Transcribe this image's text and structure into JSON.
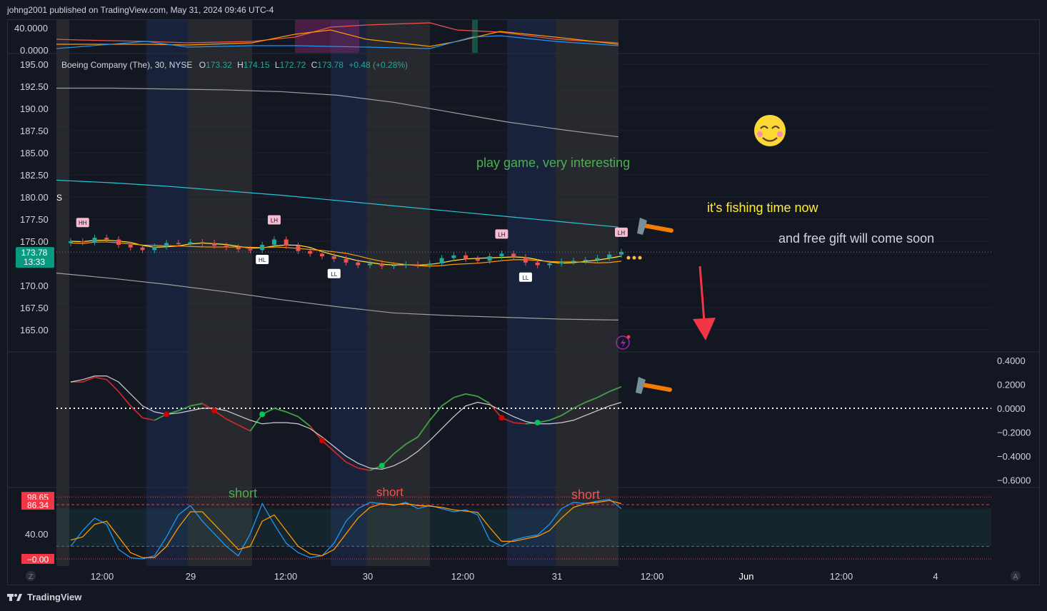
{
  "header": {
    "text": "johng2001 published on TradingView.com, May 31, 2024 09:46 UTC-4"
  },
  "footer": {
    "brand": "TradingView"
  },
  "legend": {
    "symbol": "Boeing Company (The), 30, NYSE",
    "o_label": "O",
    "o": "173.32",
    "h_label": "H",
    "h": "174.15",
    "l_label": "L",
    "l": "172.72",
    "c_label": "C",
    "c": "173.78",
    "change": "+0.48 (+0.28%)"
  },
  "price_badge": {
    "price": "173.78",
    "countdown": "13:33"
  },
  "annotations": {
    "play": "play game, very interesting",
    "fishing": "it's fishing time now",
    "gift": "and free gift will come soon",
    "short1": "short",
    "short2": "short",
    "short3": "short",
    "s_marker": "S"
  },
  "colors": {
    "bg": "#131722",
    "up": "#26a69a",
    "down": "#ef5350",
    "green_text": "#4caf50",
    "yellow_text": "#ffeb3b",
    "red_text": "#f23645",
    "pink_badge": "#f8bbd0"
  },
  "icons": [
    "smiley-icon",
    "hammer-icon",
    "down-arrow-icon",
    "lightning-icon",
    "tradingview-logo-icon"
  ],
  "chart_data": [
    {
      "type": "line",
      "panel": "top-indicator",
      "y_ticks": [
        "40.0000",
        "0.0000"
      ],
      "ylim": [
        0,
        45
      ]
    },
    {
      "type": "candlestick",
      "panel": "price",
      "y_ticks": [
        "195.00",
        "192.50",
        "190.00",
        "187.50",
        "185.00",
        "182.50",
        "180.00",
        "177.50",
        "175.00",
        "170.00",
        "167.50",
        "165.00"
      ],
      "ylim": [
        163.5,
        196.5
      ],
      "x_ticks": [
        "12:00",
        "29",
        "12:00",
        "30",
        "12:00",
        "31",
        "12:00",
        "Jun",
        "12:00",
        "4"
      ],
      "last_price": 173.78,
      "close": [
        175.0,
        174.9,
        175.4,
        175.2,
        174.6,
        174.3,
        174.0,
        174.4,
        174.8,
        174.7,
        174.9,
        174.8,
        174.5,
        174.3,
        174.1,
        174.0,
        174.6,
        175.2,
        174.5,
        173.9,
        173.6,
        173.3,
        173.0,
        172.6,
        172.3,
        172.5,
        172.2,
        172.3,
        172.4,
        172.3,
        172.5,
        173.1,
        173.4,
        173.0,
        172.8,
        173.3,
        173.6,
        173.2,
        172.6,
        172.3,
        172.5,
        172.7,
        172.8,
        172.9,
        173.1,
        173.5,
        173.8
      ],
      "pivots": [
        {
          "label": "HH",
          "idx": 1,
          "pos": "above"
        },
        {
          "label": "LH",
          "idx": 17,
          "pos": "above"
        },
        {
          "label": "HL",
          "idx": 16,
          "pos": "below"
        },
        {
          "label": "LL",
          "idx": 22,
          "pos": "below"
        },
        {
          "label": "LH",
          "idx": 36,
          "pos": "above"
        },
        {
          "label": "LL",
          "idx": 38,
          "pos": "below"
        },
        {
          "label": "LH",
          "idx": 46,
          "pos": "above"
        }
      ],
      "upper_band": [
        192.3,
        192.3,
        192.2,
        192.1,
        191.9,
        191.5,
        190.7,
        189.6,
        188.5,
        187.6,
        186.8
      ],
      "lower_band": [
        171.4,
        170.8,
        170.1,
        169.3,
        168.4,
        167.6,
        166.9,
        166.6,
        166.4,
        166.2,
        166.1
      ],
      "ema_long": [
        181.9,
        181.6,
        181.2,
        180.7,
        180.2,
        179.6,
        179.0,
        178.4,
        177.8,
        177.2,
        176.6
      ]
    },
    {
      "type": "line",
      "panel": "oscillator",
      "y_ticks": [
        "0.4000",
        "0.2000",
        "0.0000",
        "−0.2000",
        "−0.4000",
        "−0.6000"
      ],
      "ylim": [
        -0.62,
        0.42
      ],
      "series": [
        {
          "values": [
            0.22,
            0.22,
            0.26,
            0.24,
            0.14,
            0.02,
            -0.08,
            -0.1,
            -0.05,
            -0.02,
            0.02,
            0.04,
            -0.02,
            -0.09,
            -0.14,
            -0.19,
            -0.05,
            0.0,
            -0.03,
            -0.07,
            -0.15,
            -0.27,
            -0.36,
            -0.45,
            -0.5,
            -0.52,
            -0.48,
            -0.38,
            -0.3,
            -0.24,
            -0.1,
            0.02,
            0.09,
            0.12,
            0.1,
            0.04,
            -0.08,
            -0.12,
            -0.13,
            -0.12,
            -0.1,
            -0.06,
            0.0,
            0.05,
            0.09,
            0.14,
            0.18
          ]
        },
        {
          "values": [
            0.22,
            0.24,
            0.27,
            0.27,
            0.22,
            0.12,
            0.02,
            -0.03,
            -0.05,
            -0.04,
            -0.02,
            0.0,
            0.0,
            -0.02,
            -0.06,
            -0.1,
            -0.13,
            -0.12,
            -0.12,
            -0.13,
            -0.17,
            -0.24,
            -0.32,
            -0.4,
            -0.46,
            -0.5,
            -0.51,
            -0.48,
            -0.43,
            -0.36,
            -0.27,
            -0.17,
            -0.07,
            0.02,
            0.05,
            0.03,
            -0.02,
            -0.07,
            -0.11,
            -0.13,
            -0.13,
            -0.12,
            -0.1,
            -0.06,
            -0.02,
            0.02,
            0.05
          ]
        }
      ]
    },
    {
      "type": "line",
      "panel": "stochastic",
      "y_ticks": [
        "98.65",
        "86.34",
        "40.00",
        "−0.00"
      ],
      "ylim": [
        -5,
        115
      ],
      "series": [
        {
          "values": [
            20,
            45,
            65,
            55,
            15,
            2,
            0,
            5,
            35,
            70,
            85,
            60,
            40,
            20,
            5,
            40,
            88,
            55,
            25,
            10,
            2,
            5,
            25,
            60,
            80,
            90,
            88,
            85,
            90,
            80,
            85,
            80,
            75,
            78,
            70,
            30,
            20,
            30,
            35,
            38,
            55,
            80,
            90,
            88,
            92,
            95,
            80
          ]
        },
        {
          "values": [
            30,
            35,
            55,
            60,
            35,
            10,
            2,
            2,
            20,
            50,
            75,
            75,
            55,
            35,
            15,
            20,
            60,
            70,
            45,
            20,
            8,
            5,
            15,
            40,
            65,
            82,
            88,
            86,
            88,
            85,
            84,
            82,
            78,
            76,
            74,
            50,
            28,
            28,
            32,
            36,
            45,
            65,
            82,
            88,
            90,
            93,
            88
          ]
        }
      ]
    }
  ]
}
